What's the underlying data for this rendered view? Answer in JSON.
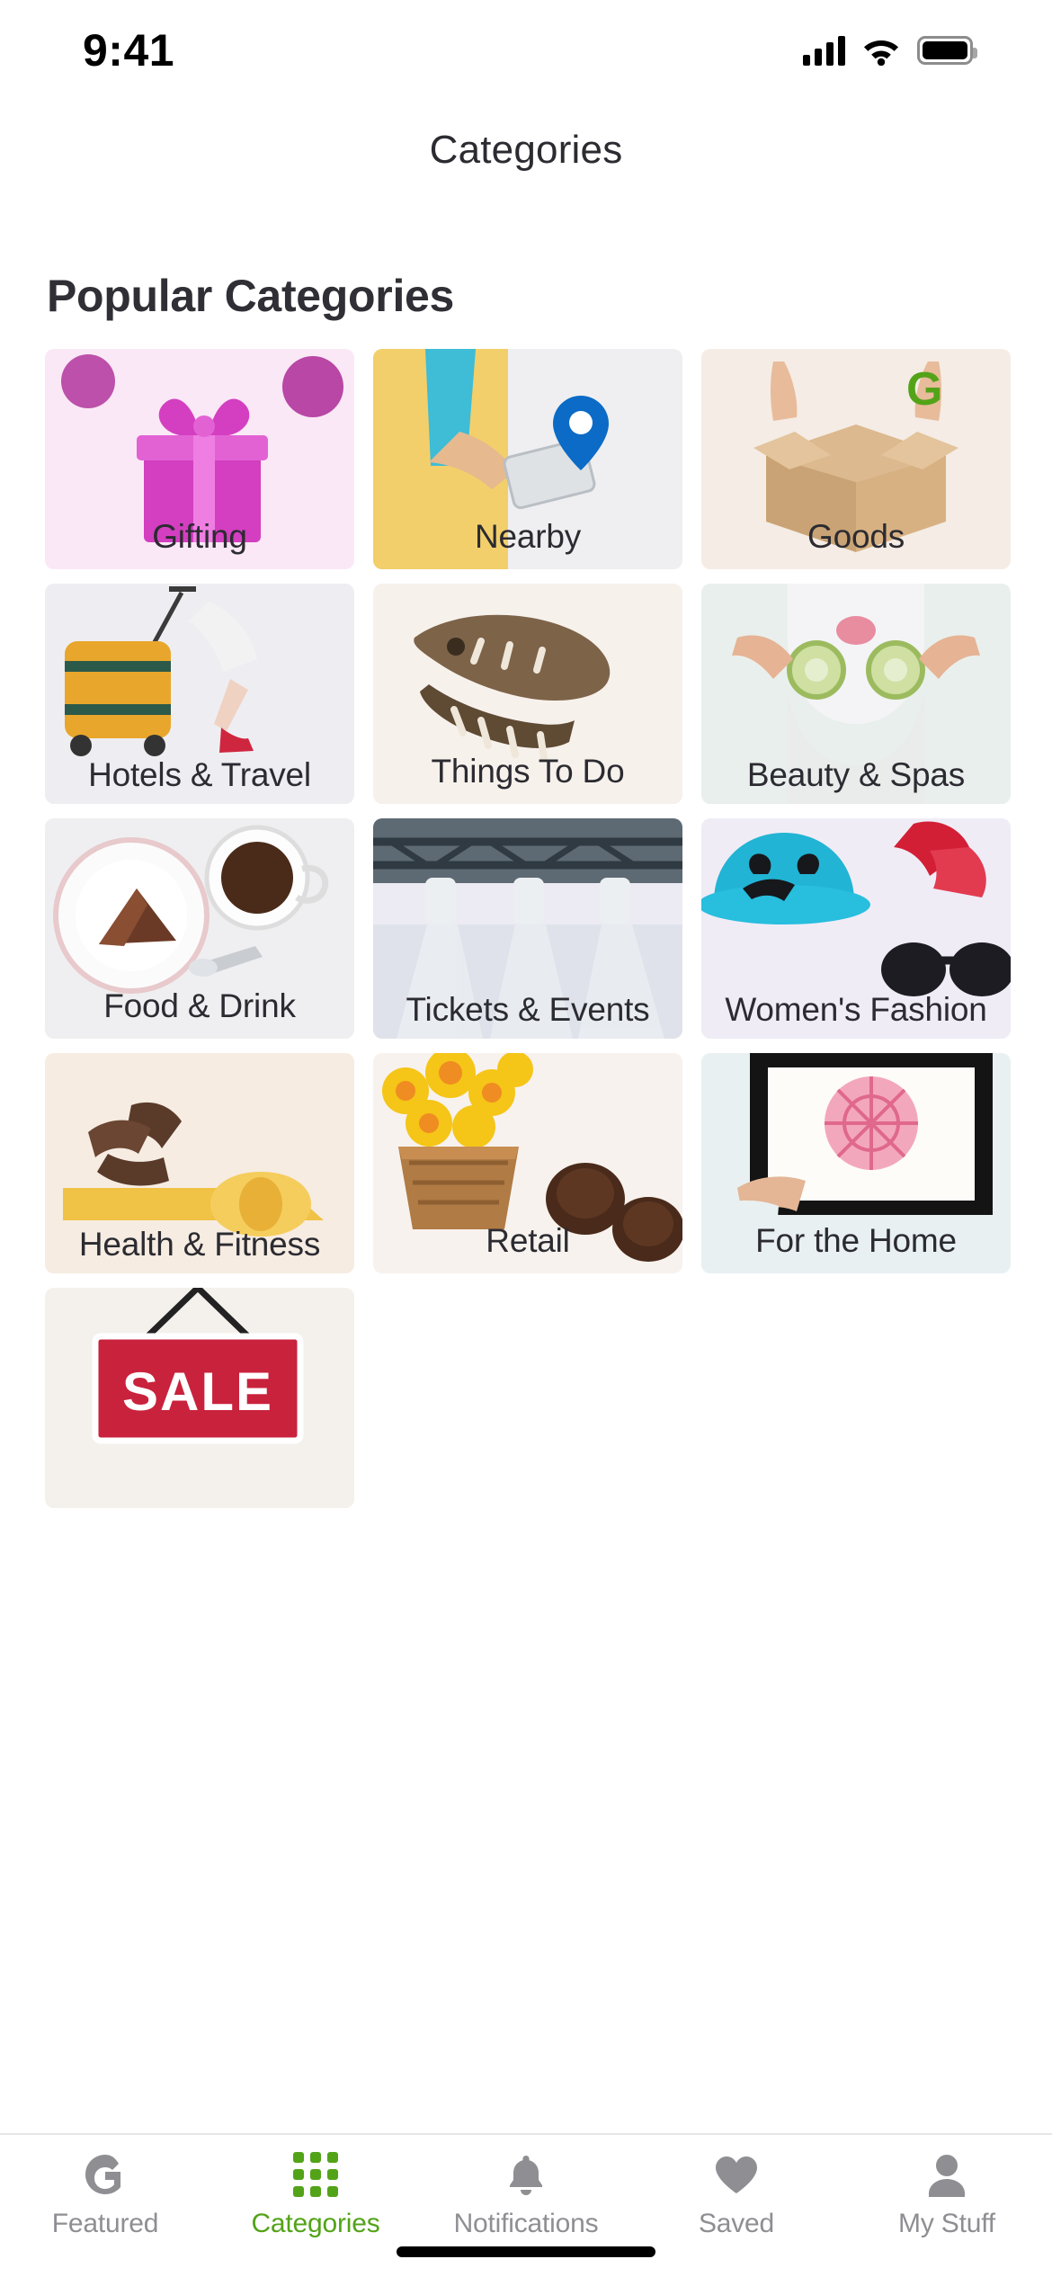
{
  "status_bar": {
    "time": "9:41",
    "icons": [
      "signal-icon",
      "wifi-icon",
      "battery-icon"
    ]
  },
  "header": {
    "title": "Categories"
  },
  "main": {
    "section_title": "Popular Categories",
    "categories": [
      {
        "label": "Gifting",
        "bg": "#fbe8f6",
        "art": "gift-box"
      },
      {
        "label": "Nearby",
        "bg": "#efeff1",
        "art": "phone-map-pin"
      },
      {
        "label": "Goods",
        "bg": "#f4ece5",
        "art": "hands-open-box"
      },
      {
        "label": "Hotels & Travel",
        "bg": "#eeeef2",
        "art": "suitcase-traveler"
      },
      {
        "label": "Things To Do",
        "bg": "#f7f1ec",
        "art": "dinosaur-skull"
      },
      {
        "label": "Beauty & Spas",
        "bg": "#e9efec",
        "art": "face-mask-cucumber"
      },
      {
        "label": "Food & Drink",
        "bg": "#efeff1",
        "art": "pie-coffee"
      },
      {
        "label": "Tickets & Events",
        "bg": "#eceaf2",
        "art": "stage-spotlights"
      },
      {
        "label": "Women's Fashion",
        "bg": "#f0ecf6",
        "art": "hat-heels-sunglasses"
      },
      {
        "label": "Health & Fitness",
        "bg": "#f6ece2",
        "art": "yoga-mat"
      },
      {
        "label": "Retail",
        "bg": "#f7f2ee",
        "art": "flowers-chocolates"
      },
      {
        "label": "For the Home",
        "bg": "#e8f0f2",
        "art": "framed-art"
      },
      {
        "label": "",
        "bg": "#f4f1ed",
        "art": "sale-sign"
      }
    ]
  },
  "tabbar": {
    "items": [
      {
        "label": "Featured",
        "icon": "g-logo-icon",
        "active": false
      },
      {
        "label": "Categories",
        "icon": "grid-icon",
        "active": true
      },
      {
        "label": "Notifications",
        "icon": "bell-icon",
        "active": false
      },
      {
        "label": "Saved",
        "icon": "heart-icon",
        "active": false
      },
      {
        "label": "My Stuff",
        "icon": "person-icon",
        "active": false
      }
    ],
    "active_color": "#53a318",
    "inactive_color": "#8e8e93"
  }
}
